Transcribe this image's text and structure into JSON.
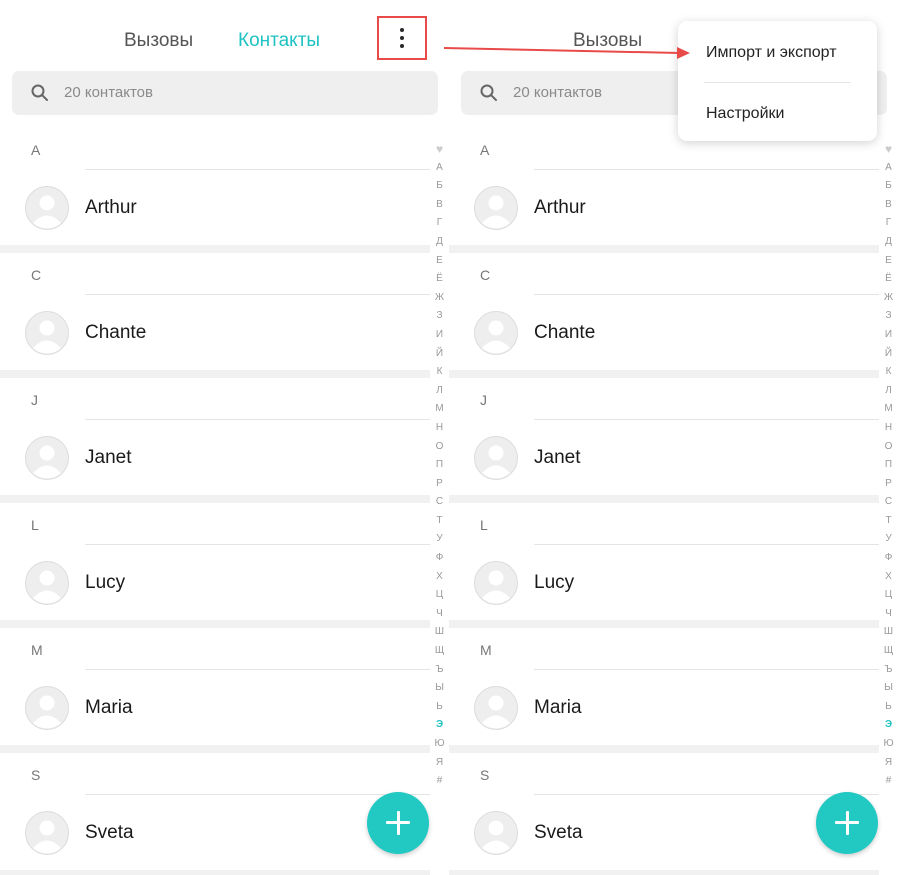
{
  "tabs": {
    "calls": "Вызовы",
    "contacts": "Контакты"
  },
  "search": {
    "placeholder": "20 контактов"
  },
  "sections": [
    {
      "letter": "A",
      "contact": "Arthur"
    },
    {
      "letter": "C",
      "contact": "Chante"
    },
    {
      "letter": "J",
      "contact": "Janet"
    },
    {
      "letter": "L",
      "contact": "Lucy"
    },
    {
      "letter": "M",
      "contact": "Maria"
    },
    {
      "letter": "S",
      "contact": "Sveta"
    }
  ],
  "index": [
    "♥",
    "А",
    "Б",
    "В",
    "Г",
    "Д",
    "Е",
    "Ё",
    "Ж",
    "З",
    "И",
    "Й",
    "К",
    "Л",
    "М",
    "Н",
    "О",
    "П",
    "Р",
    "С",
    "Т",
    "У",
    "Ф",
    "Х",
    "Ц",
    "Ч",
    "Ш",
    "Щ",
    "Ъ",
    "Ы",
    "Ь",
    "Э",
    "Ю",
    "Я",
    "#"
  ],
  "index_active": "Э",
  "menu": {
    "import_export": "Импорт и экспорт",
    "settings": "Настройки"
  },
  "colors": {
    "accent": "#1fc2c2",
    "fab": "#22c9c3",
    "highlight": "#e84a4a"
  },
  "icons": {
    "more": "more-vert-icon",
    "search": "search-icon",
    "add": "plus-icon",
    "avatar": "person-icon",
    "heart": "heart-icon"
  }
}
